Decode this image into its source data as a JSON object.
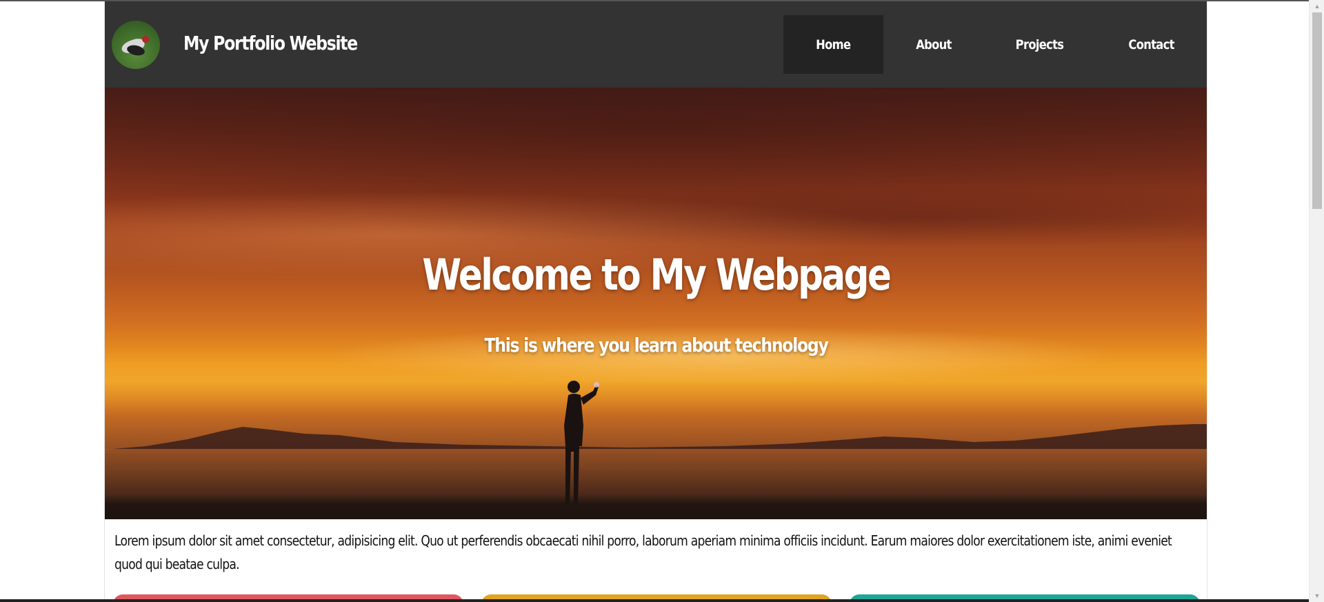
{
  "header": {
    "title": "My Portfolio Website",
    "logo_icon": "avatar-photo-icon"
  },
  "nav": {
    "items": [
      {
        "label": "Home",
        "active": true
      },
      {
        "label": "About",
        "active": false
      },
      {
        "label": "Projects",
        "active": false
      },
      {
        "label": "Contact",
        "active": false
      }
    ]
  },
  "hero": {
    "title": "Welcome to My Webpage",
    "subtitle": "This is where you learn about technology"
  },
  "intro": {
    "text": "Lorem ipsum dolor sit amet consectetur, adipisicing elit. Quo ut perferendis obcaecati nihil porro, laborum aperiam minima officiis incidunt. Earum maiores dolor exercitationem iste, animi eveniet quod qui beatae culpa."
  },
  "cards": [
    {
      "color": "#e0575f"
    },
    {
      "color": "#e0a323"
    },
    {
      "color": "#1fa597"
    }
  ],
  "colors": {
    "navbar_bg": "#333333",
    "nav_active_bg": "#232323",
    "text_light": "#ffffff",
    "text_dark": "#111111"
  },
  "scrollbar": {
    "up_icon": "chevron-up-icon",
    "down_icon": "chevron-down-icon"
  }
}
